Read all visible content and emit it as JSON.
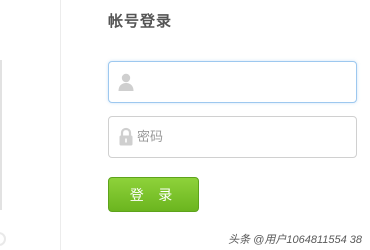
{
  "login": {
    "title": "帐号登录",
    "username": {
      "value": "",
      "placeholder": "",
      "icon": "user-icon"
    },
    "password": {
      "value": "",
      "placeholder": "密码",
      "icon": "lock-icon"
    },
    "submit_label": "登 录"
  },
  "colors": {
    "focus_border": "#9dc8ef",
    "button_green": "#6bb51f",
    "title_text": "#555555"
  },
  "watermark": "头条 @用户1064811554 38"
}
